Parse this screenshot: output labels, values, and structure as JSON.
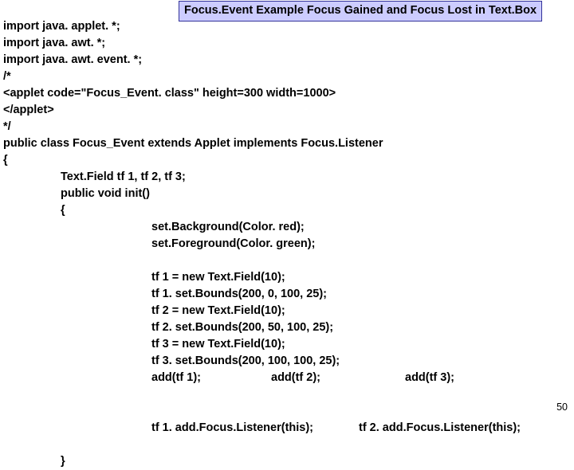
{
  "title": "Focus.Event Example Focus Gained and Focus Lost in Text.Box",
  "lines": {
    "l1": "import java. applet. *;",
    "l2": "import java. awt. *;",
    "l3": "import java. awt. event. *;",
    "l4": "/*",
    "l5": "<applet code=\"Focus_Event. class\" height=300 width=1000>",
    "l6": "</applet>",
    "l7": "*/",
    "l8": "public class Focus_Event extends Applet implements Focus.Listener",
    "l9": "{",
    "l10": "Text.Field tf 1, tf 2, tf 3;",
    "l11": "public void init()",
    "l12": "{",
    "l13": "set.Background(Color. red);",
    "l14": "set.Foreground(Color. green);",
    "l15": "tf 1 = new Text.Field(10);",
    "l16": "tf 1. set.Bounds(200, 0, 100, 25);",
    "l17": "tf 2 = new Text.Field(10);",
    "l18": "tf 2. set.Bounds(200, 50, 100, 25);",
    "l19": "tf 3 = new Text.Field(10);",
    "l20": "tf 3. set.Bounds(200, 100, 100, 25);",
    "l21a": "add(tf 1);",
    "l21b": "add(tf 2);",
    "l21c": "add(tf 3);",
    "l22a": "tf 1. add.Focus.Listener(this);",
    "l22b": "tf 2. add.Focus.Listener(this);",
    "l23": "}"
  },
  "pageNumber": "50"
}
